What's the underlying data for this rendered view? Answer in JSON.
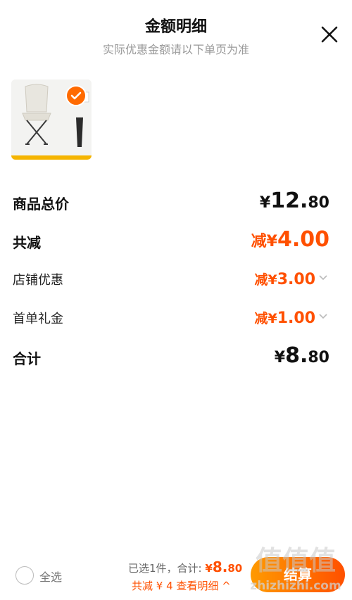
{
  "header": {
    "title": "金额明细",
    "subtitle": "实际优惠金额请以下单页为准"
  },
  "rows": {
    "total": {
      "label": "商品总价",
      "yen": "¥",
      "int": "12.",
      "dec": "80"
    },
    "reduce": {
      "label": "共减",
      "prefix": "减",
      "yen": "¥",
      "int": "4.00"
    },
    "store": {
      "label": "店铺优惠",
      "value": "减¥",
      "int": "3.00"
    },
    "first": {
      "label": "首单礼金",
      "value": "减¥",
      "int": "1.00"
    },
    "sum": {
      "label": "合计",
      "yen": "¥",
      "int": "8.",
      "dec": "80"
    }
  },
  "footer": {
    "select_all": "全选",
    "summary_prefix": "已选1件，合计: ",
    "summary_yen": "¥",
    "summary_int": "8.",
    "summary_dec": "80",
    "detail": "共减 ¥ 4  查看明细 ^",
    "checkout": "结算"
  },
  "watermark": {
    "mark": "值值值",
    "site": "zhizhizhi.com"
  },
  "colors": {
    "accent": "#ff5000",
    "thumb_bar": "#f5b400"
  }
}
